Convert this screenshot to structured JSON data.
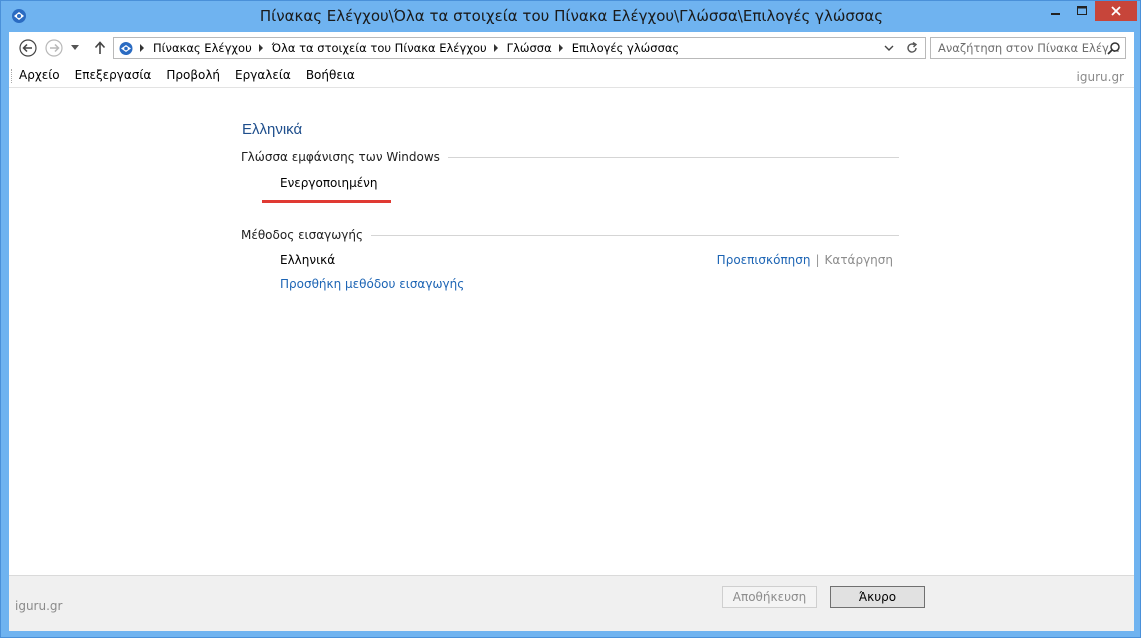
{
  "window": {
    "title": "Πίνακας Ελέγχου\\Όλα τα στοιχεία του Πίνακα Ελέγχου\\Γλώσσα\\Επιλογές γλώσσας"
  },
  "address": {
    "crumbs": [
      "Πίνακας Ελέγχου",
      "Όλα τα στοιχεία του Πίνακα Ελέγχου",
      "Γλώσσα",
      "Επιλογές γλώσσας"
    ]
  },
  "search": {
    "placeholder": "Αναζήτηση στον Πίνακα Ελέγ..."
  },
  "menu": {
    "items": [
      "Αρχείο",
      "Επεξεργασία",
      "Προβολή",
      "Εργαλεία",
      "Βοήθεια"
    ],
    "watermark": "iguru.gr"
  },
  "content": {
    "language_title": "Ελληνικά",
    "display_language": {
      "heading": "Γλώσσα εμφάνισης των Windows",
      "status": "Ενεργοποιημένη"
    },
    "input_method": {
      "heading": "Μέθοδος εισαγωγής",
      "name": "Ελληνικά",
      "preview_link": "Προεπισκόπηση",
      "separator": "|",
      "remove_link": "Κατάργηση",
      "add_link": "Προσθήκη μεθόδου εισαγωγής"
    }
  },
  "footer": {
    "watermark": "iguru.gr",
    "save_label": "Αποθήκευση",
    "cancel_label": "Άκυρο"
  },
  "colors": {
    "frame": "#6fb3f0",
    "close_button": "#c7453a",
    "link": "#1c64b4",
    "highlight_underline": "#e03a33"
  }
}
